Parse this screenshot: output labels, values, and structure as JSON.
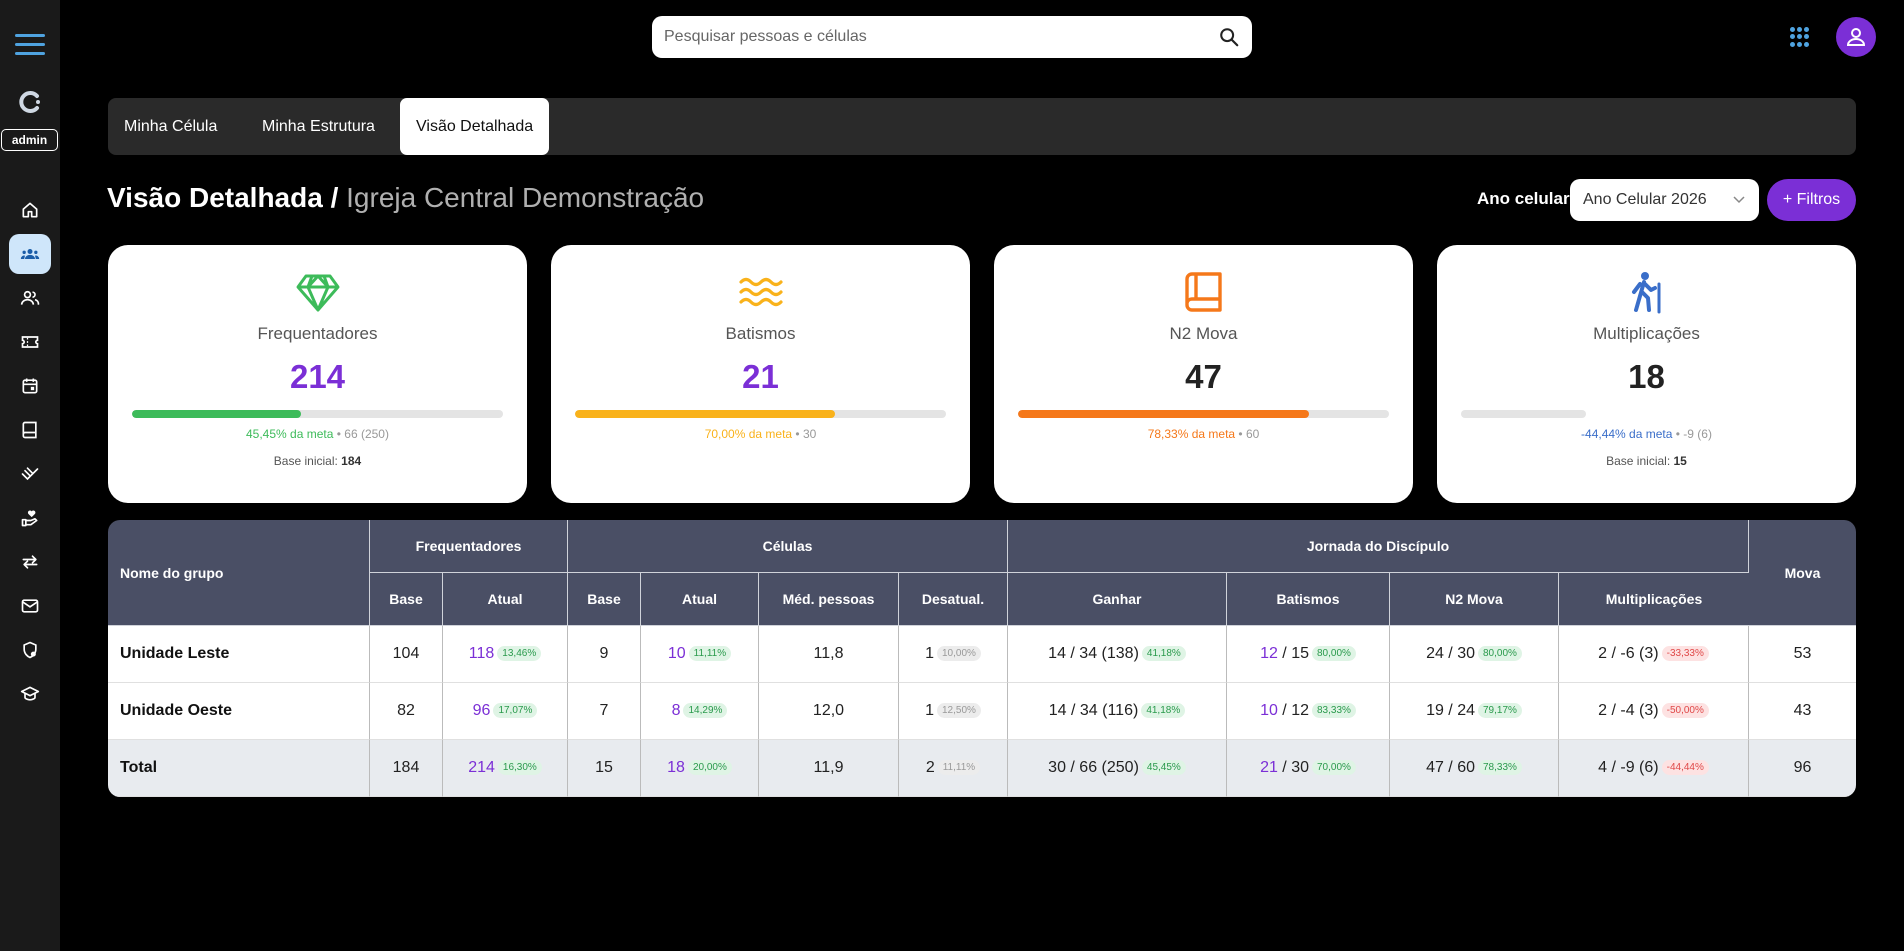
{
  "topbar": {
    "search_placeholder": "Pesquisar pessoas e células"
  },
  "sidebar": {
    "admin_label": "admin",
    "items": [
      {
        "icon": "home-icon"
      },
      {
        "icon": "groups-icon"
      },
      {
        "icon": "people-icon"
      },
      {
        "icon": "ticket-icon"
      },
      {
        "icon": "calendar-icon"
      },
      {
        "icon": "book-icon"
      },
      {
        "icon": "volunteer-icon"
      },
      {
        "icon": "hand-heart-icon"
      },
      {
        "icon": "swap-icon"
      },
      {
        "icon": "mail-icon"
      },
      {
        "icon": "shield-icon"
      },
      {
        "icon": "school-icon"
      }
    ]
  },
  "tabs": [
    "Minha Célula",
    "Minha Estrutura",
    "Visão Detalhada"
  ],
  "active_tab": "Visão Detalhada",
  "heading": {
    "title": "Visão Detalhada /",
    "subtitle": "Igreja Central Demonstração"
  },
  "filters": {
    "ano_label": "Ano celular:",
    "ano_value": "Ano Celular 2026",
    "filtros_label": "+ Filtros"
  },
  "cards": [
    {
      "label": "Frequentadores",
      "value": "214",
      "progress": 0.4545,
      "meta_pct": "45,45% da meta",
      "meta_rest": " • 66 (250)",
      "base_label": "Base inicial: ",
      "base_value": "184",
      "color": "#3dbb5a",
      "value_color": "#7b2fd6",
      "icon": "diamond-icon"
    },
    {
      "label": "Batismos",
      "value": "21",
      "progress": 0.7,
      "meta_pct": "70,00% da meta",
      "meta_rest": " • 30",
      "base_label": "",
      "base_value": "",
      "color": "#f9b21b",
      "value_color": "#7b2fd6",
      "icon": "waves-icon"
    },
    {
      "label": "N2 Mova",
      "value": "47",
      "progress": 0.7833,
      "meta_pct": "78,33% da meta",
      "meta_rest": " • 60",
      "base_label": "",
      "base_value": "",
      "color": "#f5781a",
      "value_color": "#222222",
      "icon": "book-icon"
    },
    {
      "label": "Multiplicações",
      "value": "18",
      "progress": 0,
      "meta_pct": "-44,44% da meta",
      "meta_rest": " • -9 (6)",
      "base_label": "Base inicial: ",
      "base_value": "15",
      "color": "#3a6ec9",
      "value_color": "#222222",
      "icon": "hiker-icon"
    }
  ],
  "table": {
    "col_name": "Nome do grupo",
    "groups": {
      "frequentadores": "Frequentadores",
      "celulas": "Células",
      "jornada": "Jornada do Discípulo",
      "mova": "Mova"
    },
    "sub": {
      "base": "Base",
      "atual": "Atual",
      "base2": "Base",
      "atual2": "Atual",
      "med": "Méd. pessoas",
      "desatual": "Desatual.",
      "ganhar": "Ganhar",
      "batismos": "Batismos",
      "n2": "N2 Mova",
      "mult": "Multiplicações"
    },
    "rows": [
      {
        "name": "Unidade Leste",
        "freq_base": "104",
        "freq_atual": "118",
        "freq_pct": "13,46%",
        "cel_base": "9",
        "cel_atual": "10",
        "cel_pct": "11,11%",
        "med": "11,8",
        "desatual": "1",
        "desatual_pct": "10,00%",
        "ganhar": "14 / 34 (138)",
        "ganhar_pct": "41,18%",
        "bat_cur": "12",
        "bat_rest": " / 15",
        "bat_pct": "80,00%",
        "n2": "24 / 30",
        "n2_pct": "80,00%",
        "mult": "2 / -6 (3)",
        "mult_pct": "-33,33%",
        "mova": "53"
      },
      {
        "name": "Unidade Oeste",
        "freq_base": "82",
        "freq_atual": "96",
        "freq_pct": "17,07%",
        "cel_base": "7",
        "cel_atual": "8",
        "cel_pct": "14,29%",
        "med": "12,0",
        "desatual": "1",
        "desatual_pct": "12,50%",
        "ganhar": "14 / 34 (116)",
        "ganhar_pct": "41,18%",
        "bat_cur": "10",
        "bat_rest": " / 12",
        "bat_pct": "83,33%",
        "n2": "19 / 24",
        "n2_pct": "79,17%",
        "mult": "2 / -4 (3)",
        "mult_pct": "-50,00%",
        "mova": "43"
      },
      {
        "name": "Total",
        "freq_base": "184",
        "freq_atual": "214",
        "freq_pct": "16,30%",
        "cel_base": "15",
        "cel_atual": "18",
        "cel_pct": "20,00%",
        "med": "11,9",
        "desatual": "2",
        "desatual_pct": "11,11%",
        "ganhar": "30 / 66 (250)",
        "ganhar_pct": "45,45%",
        "bat_cur": "21",
        "bat_rest": " / 30",
        "bat_pct": "70,00%",
        "n2": "47 / 60",
        "n2_pct": "78,33%",
        "mult": "4 / -9 (6)",
        "mult_pct": "-44,44%",
        "mova": "96"
      }
    ]
  }
}
